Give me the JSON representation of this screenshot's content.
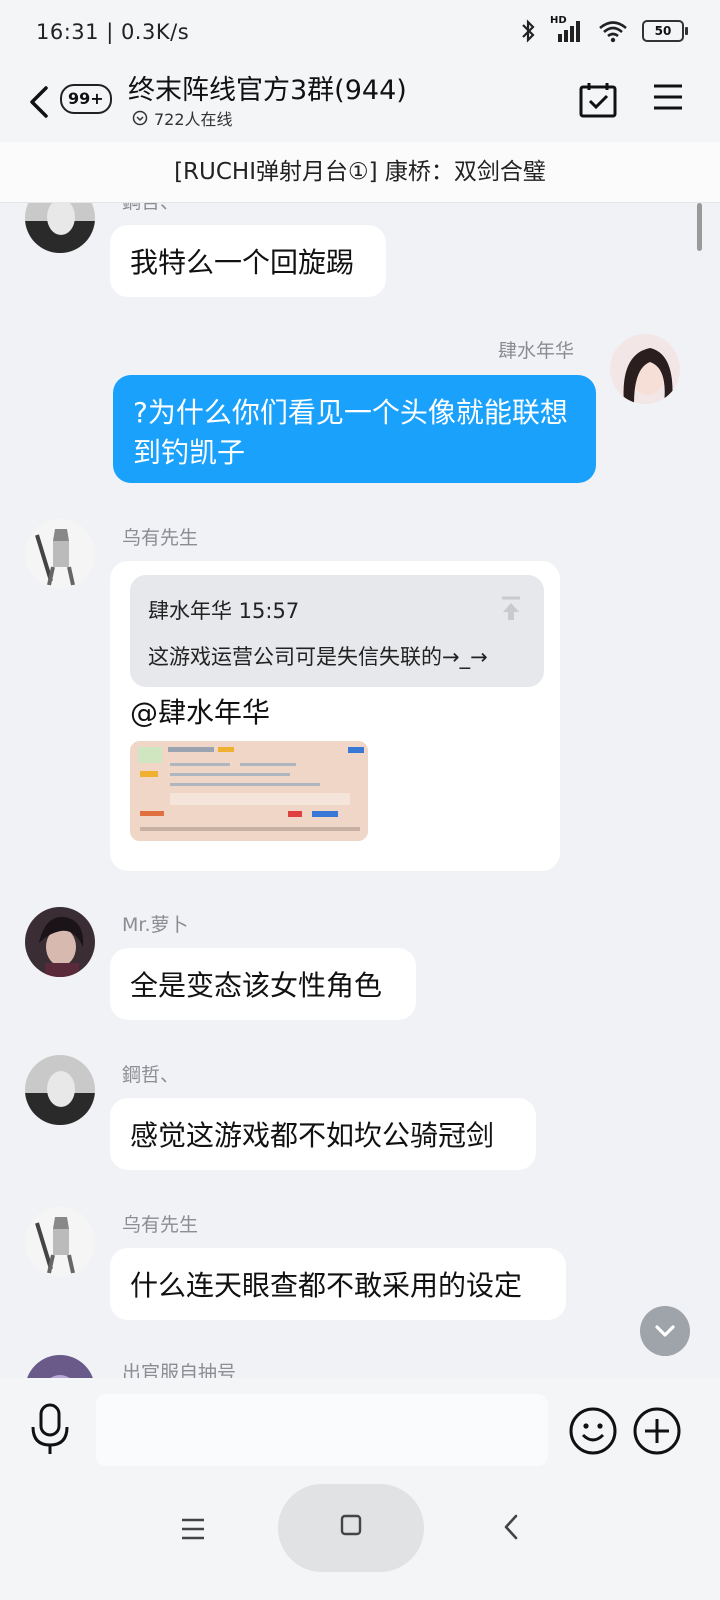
{
  "status": {
    "time_speed": "16:31 | 0.3K/s",
    "network_tag": "HD",
    "battery": "50"
  },
  "header": {
    "unread_badge": "99+",
    "title": "终末阵线官方3群(944)",
    "online": "722人在线"
  },
  "pinned": {
    "text": "[RUCHI弹射月台①] 康桥：双剑合璧"
  },
  "messages": [
    {
      "sender": "鋼哲、",
      "text": "我特么一个回旋踢"
    },
    {
      "sender": "肆水年华",
      "text": "?为什么你们看见一个头像就能联想到钓凯子"
    },
    {
      "sender": "乌有先生",
      "quote_meta": "肆水年华 15:57",
      "quote_text": "这游戏运营公司可是失信失联的→_→",
      "text": "@肆水年华"
    },
    {
      "sender": "Mr.萝卜",
      "text": "全是变态该女性角色"
    },
    {
      "sender": "鋼哲、",
      "text": "感觉这游戏都不如坎公骑冠剑"
    },
    {
      "sender": "乌有先生",
      "text": "什么连天眼查都不敢采用的设定"
    },
    {
      "sender": "出官服自抽号",
      "text": ""
    }
  ],
  "input": {
    "placeholder": ""
  }
}
